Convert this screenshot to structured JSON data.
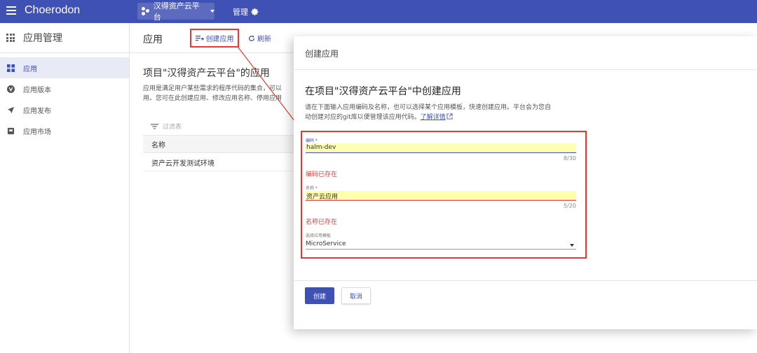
{
  "app": {
    "brand": "Choerodon"
  },
  "topbar": {
    "project": "汉得资产云平台",
    "manage": "管理"
  },
  "sidebar": {
    "title": "应用管理",
    "items": [
      {
        "label": "应用",
        "icon": "apps-icon"
      },
      {
        "label": "应用版本",
        "icon": "version-icon"
      },
      {
        "label": "应用发布",
        "icon": "send-icon"
      },
      {
        "label": "应用市场",
        "icon": "store-icon"
      }
    ]
  },
  "main": {
    "title": "应用",
    "create_label": "创建应用",
    "refresh_label": "刷新",
    "section_title": "项目\"汉得资产云平台\"的应用",
    "desc_line1": "应用是满足用户某些需求的程序代码的集合，可以",
    "desc_line2": "用。您可在此创建应用、修改应用名称、停用应用",
    "filter_placeholder": "过滤表",
    "table": {
      "header": "名称",
      "rows": [
        "资产云开发测试环境"
      ]
    }
  },
  "modal": {
    "title": "创建应用",
    "subtitle": "在项目\"汉得资产云平台\"中创建应用",
    "desc_line1": "请在下面输入应用编码及名称，也可以选择某个应用模板，快速创建应用。平台会为您自",
    "desc_line2": "动创建对应的git库以便管理该应用代码。",
    "learn_more": "了解详情",
    "code": {
      "label": "编码 *",
      "value": "halm-dev",
      "count": "8/30",
      "error": "编码已存在"
    },
    "name": {
      "label": "名称 *",
      "value": "资产云应用",
      "count": "5/20",
      "error": "名称已存在"
    },
    "template": {
      "label": "选择应用模板",
      "value": "MicroService"
    },
    "ok_label": "创建",
    "cancel_label": "取消"
  },
  "colors": {
    "primary": "#3f51b5",
    "error": "#e53935",
    "highlight": "#ffffb0"
  }
}
